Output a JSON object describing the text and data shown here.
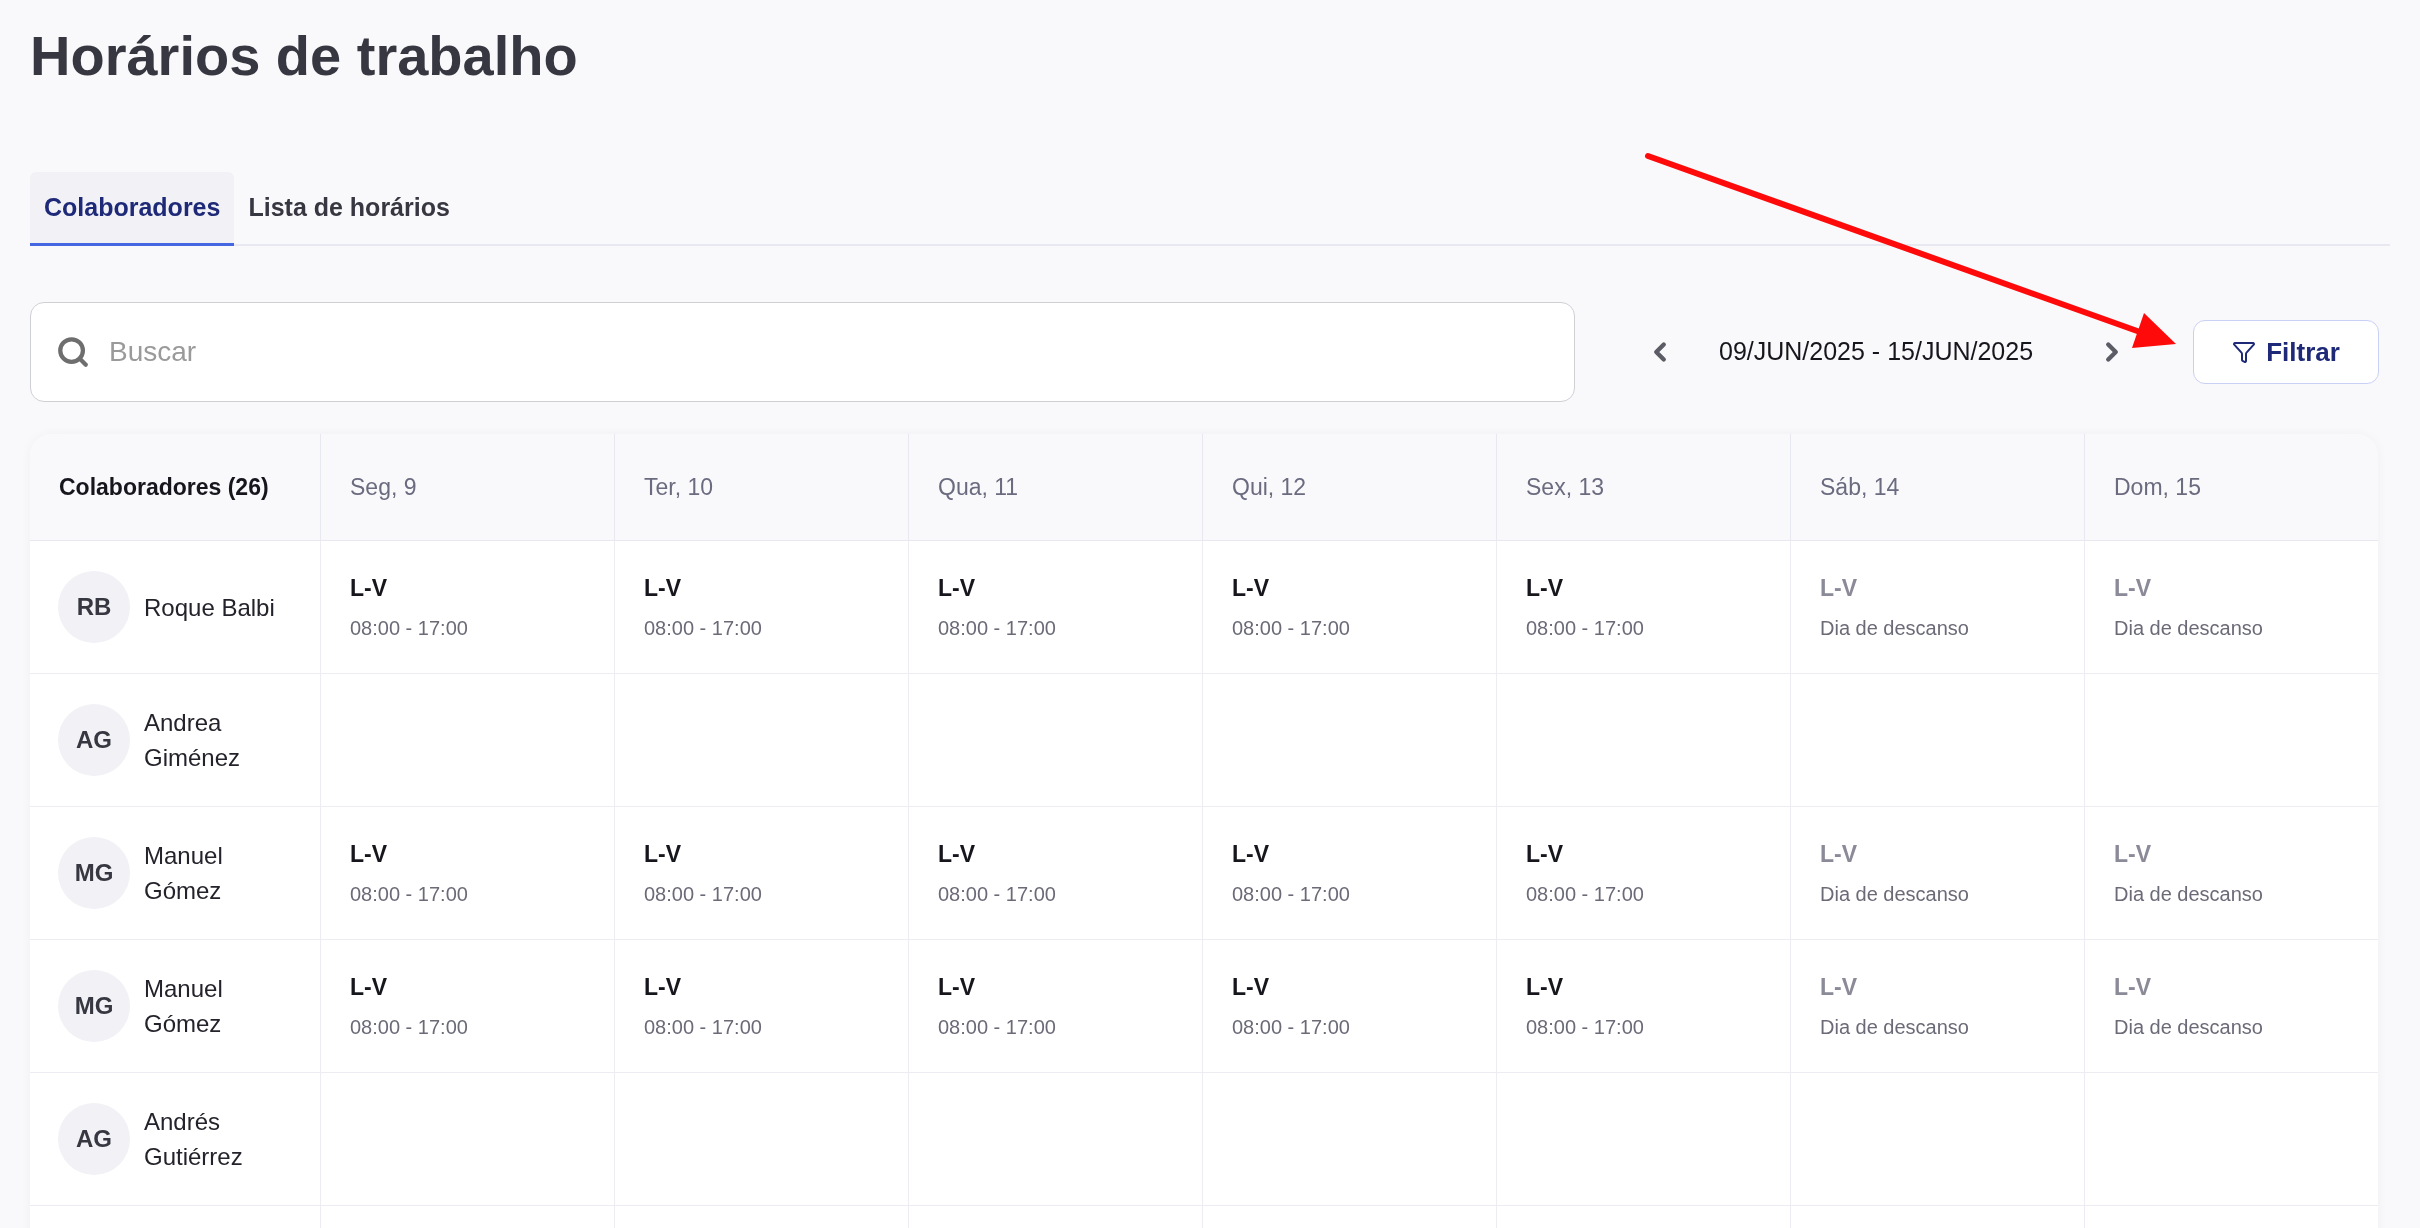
{
  "title": "Horários de trabalho",
  "tabs": [
    {
      "label": "Colaboradores",
      "selected": true
    },
    {
      "label": "Lista de horários",
      "selected": false
    }
  ],
  "search": {
    "placeholder": "Buscar"
  },
  "date_range": "09/JUN/2025 - 15/JUN/2025",
  "filter_button": "Filtrar",
  "table": {
    "employee_header": "Colaboradores (26)",
    "columns": [
      "Seg, 9",
      "Ter, 10",
      "Qua, 11",
      "Qui, 12",
      "Sex, 13",
      "Sáb, 14",
      "Dom, 15"
    ],
    "rows": [
      {
        "initials": "RB",
        "name": "Roque Balbi",
        "cells": [
          {
            "kind": "work",
            "title": "L-V",
            "detail": "08:00 - 17:00"
          },
          {
            "kind": "work",
            "title": "L-V",
            "detail": "08:00 - 17:00"
          },
          {
            "kind": "work",
            "title": "L-V",
            "detail": "08:00 - 17:00"
          },
          {
            "kind": "work",
            "title": "L-V",
            "detail": "08:00 - 17:00"
          },
          {
            "kind": "work",
            "title": "L-V",
            "detail": "08:00 - 17:00"
          },
          {
            "kind": "rest",
            "title": "L-V",
            "detail": "Dia de descanso"
          },
          {
            "kind": "rest",
            "title": "L-V",
            "detail": "Dia de descanso"
          }
        ]
      },
      {
        "initials": "AG",
        "name": "Andrea Giménez",
        "cells": []
      },
      {
        "initials": "MG",
        "name": "Manuel Gómez",
        "cells": [
          {
            "kind": "work",
            "title": "L-V",
            "detail": "08:00 - 17:00"
          },
          {
            "kind": "work",
            "title": "L-V",
            "detail": "08:00 - 17:00"
          },
          {
            "kind": "work",
            "title": "L-V",
            "detail": "08:00 - 17:00"
          },
          {
            "kind": "work",
            "title": "L-V",
            "detail": "08:00 - 17:00"
          },
          {
            "kind": "work",
            "title": "L-V",
            "detail": "08:00 - 17:00"
          },
          {
            "kind": "rest",
            "title": "L-V",
            "detail": "Dia de descanso"
          },
          {
            "kind": "rest",
            "title": "L-V",
            "detail": "Dia de descanso"
          }
        ]
      },
      {
        "initials": "MG",
        "name": "Manuel Gómez",
        "cells": [
          {
            "kind": "work",
            "title": "L-V",
            "detail": "08:00 - 17:00"
          },
          {
            "kind": "work",
            "title": "L-V",
            "detail": "08:00 - 17:00"
          },
          {
            "kind": "work",
            "title": "L-V",
            "detail": "08:00 - 17:00"
          },
          {
            "kind": "work",
            "title": "L-V",
            "detail": "08:00 - 17:00"
          },
          {
            "kind": "work",
            "title": "L-V",
            "detail": "08:00 - 17:00"
          },
          {
            "kind": "rest",
            "title": "L-V",
            "detail": "Dia de descanso"
          },
          {
            "kind": "rest",
            "title": "L-V",
            "detail": "Dia de descanso"
          }
        ]
      },
      {
        "initials": "AG",
        "name": "Andrés Gutiérrez",
        "cells": []
      }
    ]
  }
}
